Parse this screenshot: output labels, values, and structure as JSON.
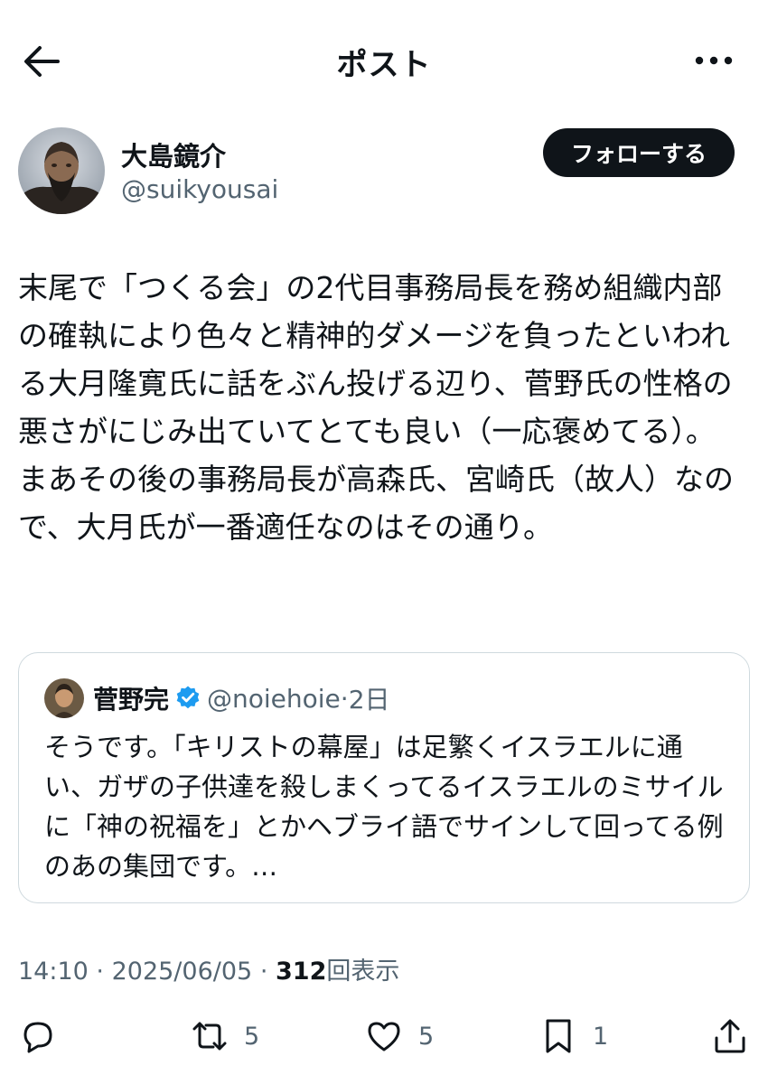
{
  "header": {
    "title": "ポスト",
    "back_icon": "arrow-left-icon",
    "more_icon": "more-horizontal-icon"
  },
  "author": {
    "display_name": "大島鏡介",
    "handle": "@suikyousai",
    "follow_label": "フォローする"
  },
  "post": {
    "text": "末尾で「つくる会」の2代目事務局長を務め組織内部の確執により色々と精神的ダメージを負ったといわれる大月隆寛氏に話をぶん投げる辺り、菅野氏の性格の悪さがにじみ出ていてとても良い（一応褒めてる）。\nまあその後の事務局長が高森氏、宮崎氏（故人）なので、大月氏が一番適任なのはその通り。"
  },
  "quote": {
    "display_name": "菅野完",
    "handle": "@noiehoie",
    "separator": "·",
    "time": "2日",
    "text": "そうです。「キリストの幕屋」は足繁くイスラエルに通い、ガザの子供達を殺しまくってるイスラエルのミサイルに「神の祝福を」とかヘブライ語でサインして回ってる例のあの集団です。…",
    "verified_color": "#1d9bf0"
  },
  "meta": {
    "time": "14:10",
    "separator": "·",
    "date": "2025/06/05",
    "views": "312",
    "views_label": "回表示"
  },
  "actions": {
    "reply_count": "",
    "retweet_count": "5",
    "like_count": "5",
    "bookmark_count": "1"
  }
}
